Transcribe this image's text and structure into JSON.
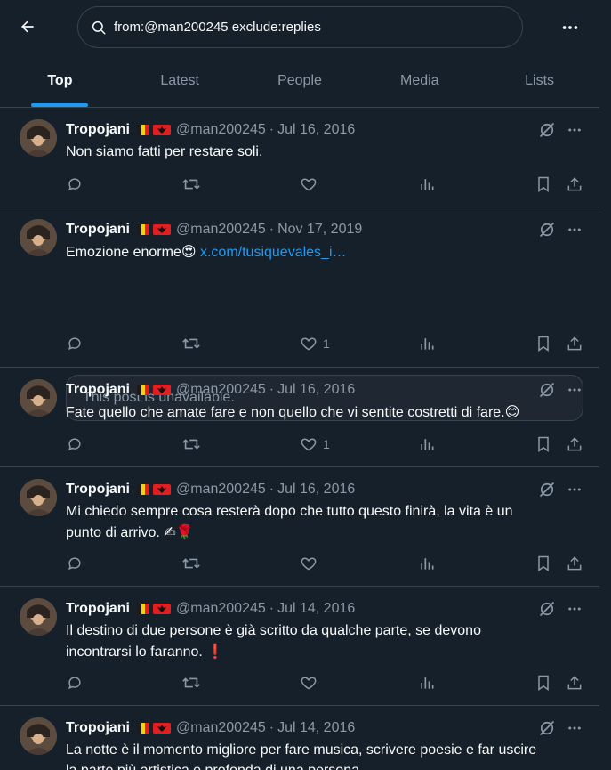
{
  "search": {
    "query": "from:@man200245 exclude:replies"
  },
  "tabs": [
    {
      "label": "Top",
      "active": true
    },
    {
      "label": "Latest"
    },
    {
      "label": "People"
    },
    {
      "label": "Media"
    },
    {
      "label": "Lists"
    }
  ],
  "colors": {
    "background": "#15202b",
    "accent": "#1d9bf0",
    "muted": "#8b98a5",
    "border": "#38444d",
    "text": "#f7f9f9"
  },
  "posts": [
    {
      "author": "Tropojani",
      "handle": "@man200245",
      "date": "Jul 16, 2016",
      "text": "Non siamo fatti per restare soli.",
      "likes": ""
    },
    {
      "author": "Tropojani",
      "handle": "@man200245",
      "date": "Nov 17, 2019",
      "text": "Emozione enorme",
      "emoji": "😍",
      "link": "x.com/tusiquevales_i…",
      "card": "This post is unavailable.",
      "likes": "1"
    },
    {
      "author": "Tropojani",
      "handle": "@man200245",
      "date": "Jul 16, 2016",
      "text": "Fate quello che amate fare e non quello che vi sentite costretti di fare.",
      "emoji": "😊",
      "likes": "1"
    },
    {
      "author": "Tropojani",
      "handle": "@man200245",
      "date": "Jul 16, 2016",
      "line1": "Mi chiedo sempre cosa resterà dopo che tutto questo finirà, la vita è un",
      "line2": "punto di arrivo. ",
      "emoji": "✍🌹",
      "likes": ""
    },
    {
      "author": "Tropojani",
      "handle": "@man200245",
      "date": "Jul 14, 2016",
      "line1": "Il destino di due persone è già scritto da qualche parte, se devono",
      "line2": "incontrarsi lo faranno. ",
      "emoji": "❗",
      "likes": ""
    },
    {
      "author": "Tropojani",
      "handle": "@man200245",
      "date": "Jul 14, 2016",
      "line1": "La notte è il momento migliore per fare musica, scrivere poesie e far uscire",
      "line2": "la parte più artistica e profonda di una persona."
    }
  ]
}
